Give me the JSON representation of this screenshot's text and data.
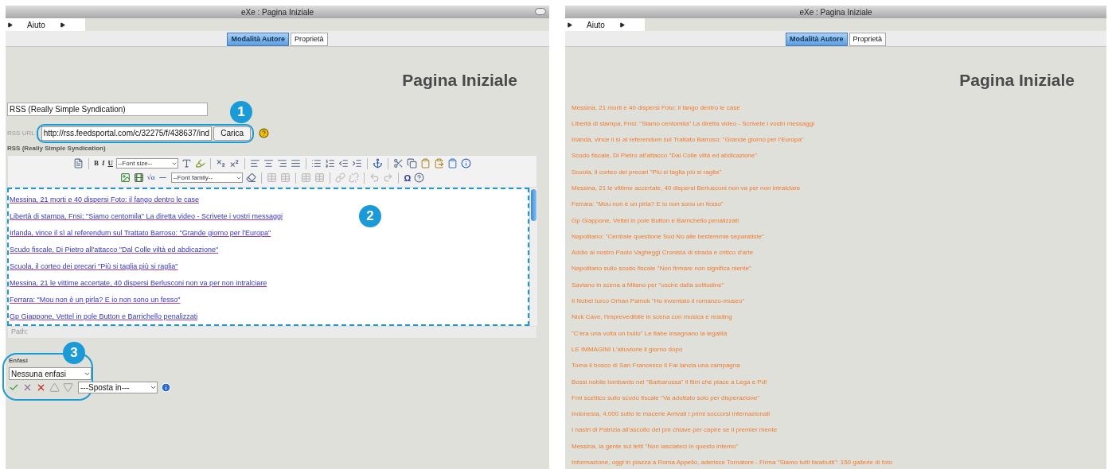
{
  "windows": [
    {
      "kind": "editor",
      "title": "eXe : Pagina Iniziale",
      "menu": [
        {
          "label": "Aiuto"
        }
      ],
      "tabs": [
        {
          "label": "Modalità Autore",
          "selected": true
        },
        {
          "label": "Proprietà",
          "selected": false
        }
      ],
      "heading": "Pagina Iniziale",
      "idevice_title": "RSS (Really Simple Syndication)",
      "rss_url": {
        "label": "RSS URL",
        "value": "http://rss.feedsportal.com/c/32275/f/438637/ind",
        "button": "Carica"
      },
      "field_label": "RSS (Really Simple Syndication)",
      "toolbar": {
        "bold": "B",
        "italic": "I",
        "underline": "U",
        "font_size": "--Font size--",
        "font_family": "--Font family--",
        "special": "Ω",
        "math": "√α"
      },
      "links": [
        "Messina, 21 morti e 40 dispersi Foto: il fango dentro le case",
        "Libertà di stampa, Fnsi: \"Siamo centomila\" La diretta video - Scrivete i vostri messaggi",
        "Irlanda, vince il sì al referendum sul Trattato Barroso: \"Grande giorno per l'Europa\"",
        "Scudo fiscale, Di Pietro all'attacco \"Dal Colle viltà ed abdicazione\"",
        "Scuola, il corteo dei precari \"Più si taglia più si raglia\"",
        "Messina, 21 le vittime accertate, 40 dispersi Berlusconi non va per non intralciare",
        "Ferrara: \"Mou non è un pirla? E io non sono un fesso\"",
        "Gp Giappone, Vettel in pole Button e Barrichello penalizzati"
      ],
      "path_label": "Path:",
      "emphasis": {
        "label": "Enfasi",
        "value": "Nessuna enfasi"
      },
      "move_to": "---Sposta in---",
      "callouts": [
        "1",
        "2",
        "3"
      ]
    },
    {
      "kind": "preview",
      "title": "eXe : Pagina Iniziale",
      "menu": [
        {
          "label": "Aiuto"
        }
      ],
      "tabs": [
        {
          "label": "Modalità Autore",
          "selected": true
        },
        {
          "label": "Proprietà",
          "selected": false
        }
      ],
      "heading": "Pagina Iniziale",
      "links": [
        "Messina, 21 morti e 40 dispersi Foto: il fango dentro le case",
        "Libertà di stampa, Fnsi: \"Siamo centomila\" La diretta video - Scrivete i vostri messaggi",
        "Irlanda, vince il sì al referendum sul Trattato Barroso: \"Grande giorno per l'Europa\"",
        "Scudo fiscale, Di Pietro all'attacco \"Dal Colle viltà ed abdicazione\"",
        "Scuola, il corteo dei precari \"Più si taglia più si raglia\"",
        "Messina, 21 le vittime accertate, 40 dispersi Berlusconi non va per non intralciare",
        "Ferrara: \"Mou non è un pirla? E io non sono un fesso\"",
        "Gp Giappone, Vettel in pole Button e Barrichello penalizzati",
        "Napolitano: \"Centrale questione Sud No alle bestemmie separatiste\"",
        "Addio al nostro Paolo Vagheggi Cronista di strada e critico d'arte",
        "Napolitano sullo scudo fiscale \"Non firmare non significa niente\"",
        "Saviano in scena a Milano per \"uscire dalla solitudine\"",
        "Il Nobel turco Orhan Pamuk \"Ho inventato il romanzo-museo\"",
        "Nick Cave, l'imprevedibile in scena con musica e reading",
        "\"C'era una volta un bullo\" Le fiabe insegnano la legalità",
        "LE IMMAGINI L'alluvione il giorno dopo",
        "Torna il bosco di San Francesco Il Fai lancia una campagna",
        "Bossi nobile lombardo nel \"Barbarossa\" Il film che piace a Lega e Pdl",
        "Fmi scettico sullo scudo fiscale \"Va adottato solo per disperazione\"",
        "Indonesia, 4.000 sotto le macerie Arrivati i primi soccorsi internazionali",
        "I nastri di Patrizia all'ascolto del pm chiave per capire se il premier mente",
        "Messina, la gente sui tetti \"Non lasciateci in questo inferno\"",
        "Informazione, oggi in piazza a Roma Appello, aderisce Tornatore - Firma \"Siamo tutti farabutti\": 150 gallerie di foto"
      ]
    }
  ]
}
